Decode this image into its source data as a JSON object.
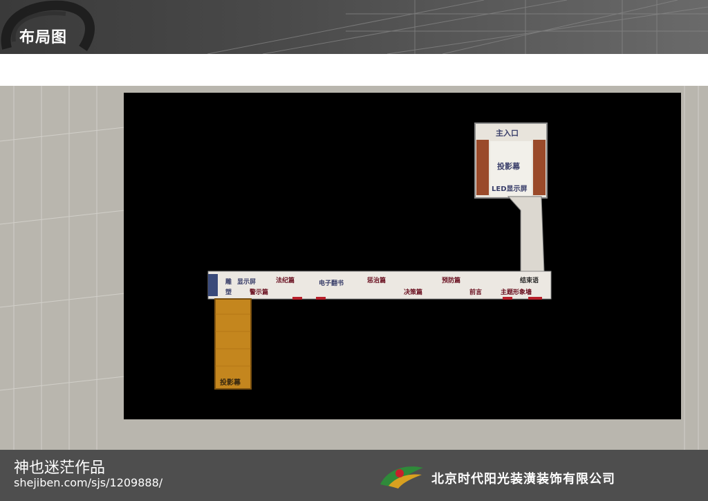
{
  "header": {
    "title": "布局图"
  },
  "plan": {
    "labels": {
      "main_entrance": "主入口",
      "projection_screen_top": "投影幕",
      "led_screen": "LED显示屏",
      "ending_hall": "结束语",
      "theme_wall": "主题形象墙",
      "preface": "前言",
      "prevention": "预防篇",
      "decision": "决策篇",
      "punishment": "惩治篇",
      "ebook": "电子翻书",
      "discipline": "法纪篇",
      "warning": "警示篇",
      "display_screen": "显示屏",
      "sculpture_1": "雕",
      "sculpture_2": "塑",
      "projection_screen_bottom": "投影幕"
    }
  },
  "footer": {
    "author": "神也迷茫作品",
    "url": "shejiben.com/sjs/1209888/",
    "company": "北京时代阳光装潢装饰有限公司"
  }
}
